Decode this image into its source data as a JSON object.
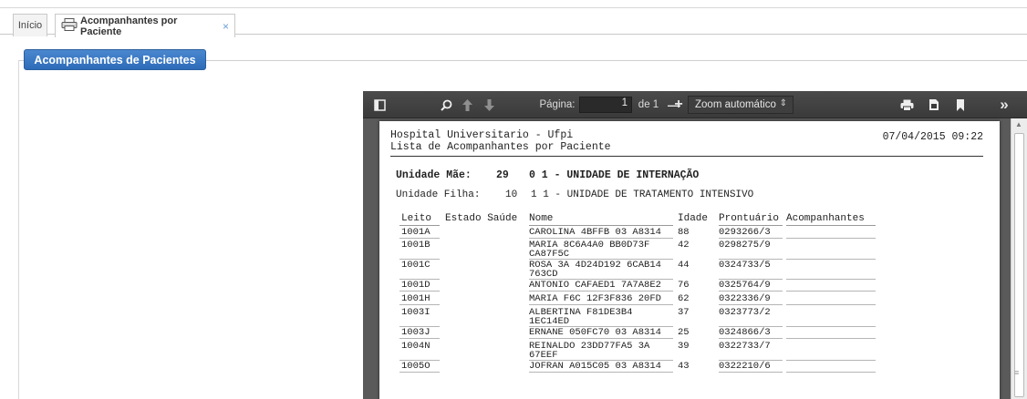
{
  "tabs": {
    "home_label": "Início",
    "active_label": "Acompanhantes por Paciente",
    "close_glyph": "×"
  },
  "panel": {
    "title": "Acompanhantes de Pacientes"
  },
  "viewer": {
    "toolbar": {
      "page_label": "Página:",
      "page_value": "1",
      "page_count": "de 1",
      "zoom_minus": "—",
      "zoom_plus": "+",
      "zoom_value": "Zoom automático",
      "more_glyph": "»"
    }
  },
  "report": {
    "hospital": "Hospital Universitario - Ufpi",
    "subtitle": "Lista de Acompanhantes por Paciente",
    "datetime": "07/04/2015 09:22",
    "unidade_mae_label": "Unidade Mãe:",
    "unidade_mae_code": "29",
    "unidade_mae_name": "0 1 - UNIDADE DE INTERNAÇÃO",
    "unidade_filha_label": "Unidade Filha:",
    "unidade_filha_code": "10",
    "unidade_filha_name": "1 1 - UNIDADE DE TRATAMENTO INTENSIVO",
    "columns": [
      "Leito",
      "Estado Saúde",
      "Nome",
      "Idade",
      "Prontuário",
      "Acompanhantes"
    ],
    "rows": [
      {
        "leito": "1001A",
        "nome": "CAROLINA 4BFFB 03 A8314",
        "idade": "88",
        "prontuario": "0293266/3"
      },
      {
        "leito": "1001B",
        "nome": "MARIA 8C6A4A0 BB0D73F CA87F5C",
        "idade": "42",
        "prontuario": "0298275/9"
      },
      {
        "leito": "1001C",
        "nome": "ROSA 3A 4D24D192 6CAB14 763CD",
        "idade": "44",
        "prontuario": "0324733/5"
      },
      {
        "leito": "1001D",
        "nome": "ANTONIO CAFAED1 7A7A8E2",
        "idade": "76",
        "prontuario": "0325764/9"
      },
      {
        "leito": "1001H",
        "nome": "MARIA F6C 12F3F836 20FD",
        "idade": "62",
        "prontuario": "0322336/9"
      },
      {
        "leito": "1003I",
        "nome": "ALBERTINA F81DE3B4 1EC14ED",
        "idade": "37",
        "prontuario": "0323773/2"
      },
      {
        "leito": "1003J",
        "nome": "ERNANE 050FC70 03 A8314",
        "idade": "25",
        "prontuario": "0324866/3"
      },
      {
        "leito": "1004N",
        "nome": "REINALDO 23DD77FA5 3A 67EEF",
        "idade": "39",
        "prontuario": "0322733/7"
      },
      {
        "leito": "1005O",
        "nome": "JOFRAN A015C05 03 A8314",
        "idade": "43",
        "prontuario": "0322210/6"
      }
    ]
  }
}
